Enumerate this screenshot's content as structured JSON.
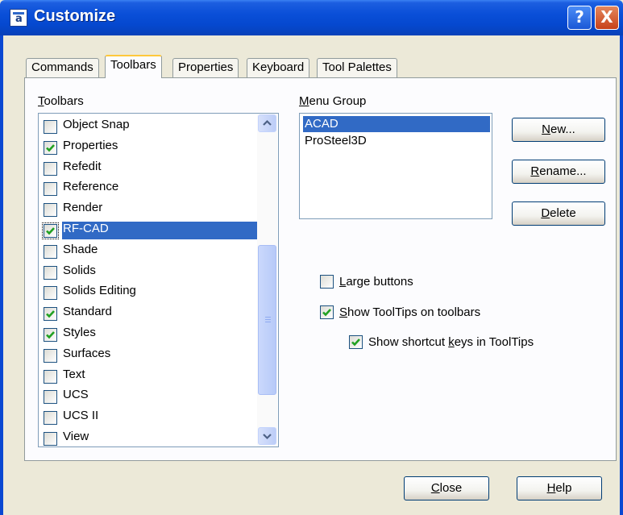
{
  "window": {
    "title": "Customize",
    "help_glyph": "?",
    "close_glyph": "X"
  },
  "tabs": [
    {
      "label": "Commands",
      "active": false
    },
    {
      "label": "Toolbars",
      "active": true
    },
    {
      "label": "Properties",
      "active": false
    },
    {
      "label": "Keyboard",
      "active": false
    },
    {
      "label": "Tool Palettes",
      "active": false
    }
  ],
  "toolbars": {
    "label_first": "T",
    "label_rest": "oolbars",
    "items": [
      {
        "label": "Object Snap",
        "checked": false,
        "selected": false
      },
      {
        "label": "Properties",
        "checked": true,
        "selected": false
      },
      {
        "label": "Refedit",
        "checked": false,
        "selected": false
      },
      {
        "label": "Reference",
        "checked": false,
        "selected": false
      },
      {
        "label": "Render",
        "checked": false,
        "selected": false
      },
      {
        "label": "RF-CAD",
        "checked": true,
        "selected": true
      },
      {
        "label": "Shade",
        "checked": false,
        "selected": false
      },
      {
        "label": "Solids",
        "checked": false,
        "selected": false
      },
      {
        "label": "Solids Editing",
        "checked": false,
        "selected": false
      },
      {
        "label": "Standard",
        "checked": true,
        "selected": false
      },
      {
        "label": "Styles",
        "checked": true,
        "selected": false
      },
      {
        "label": "Surfaces",
        "checked": false,
        "selected": false
      },
      {
        "label": "Text",
        "checked": false,
        "selected": false
      },
      {
        "label": "UCS",
        "checked": false,
        "selected": false
      },
      {
        "label": "UCS II",
        "checked": false,
        "selected": false
      },
      {
        "label": "View",
        "checked": false,
        "selected": false
      }
    ]
  },
  "menu_group": {
    "label_first": "M",
    "label_rest": "enu Group",
    "items": [
      {
        "label": "ACAD",
        "selected": true
      },
      {
        "label": "ProSteel3D",
        "selected": false
      }
    ]
  },
  "buttons": {
    "new": {
      "first": "N",
      "rest": "ew..."
    },
    "rename": {
      "first": "R",
      "rest": "ename..."
    },
    "delete": {
      "first": "D",
      "rest": "elete"
    },
    "close": {
      "first": "C",
      "rest": "lose"
    },
    "help": {
      "first": "H",
      "rest": "elp"
    }
  },
  "options": {
    "large_buttons": {
      "first": "L",
      "rest": "arge buttons",
      "checked": false
    },
    "show_tooltips": {
      "first": "S",
      "rest": "how ToolTips on toolbars",
      "checked": true
    },
    "show_shortcut": {
      "pre": "Show shortcut ",
      "first": "k",
      "rest": "eys in ToolTips",
      "checked": true
    }
  },
  "colors": {
    "titlebar": "#0a4fd8",
    "selection": "#316ac5",
    "check": "#21a121",
    "dialog_bg": "#ece9d8"
  }
}
